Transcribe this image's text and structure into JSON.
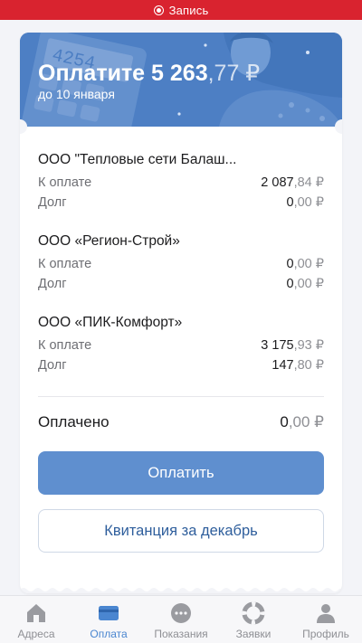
{
  "status_bar": {
    "recording_label": "Запись"
  },
  "banner": {
    "title_main": "Оплатите 5 263",
    "title_kopecks": ",77 ₽",
    "due_text": "до 10 января"
  },
  "bills": [
    {
      "company": "ООО \"Тепловые сети Балаш...",
      "to_pay_label": "К оплате",
      "to_pay_rub": "2 087",
      "to_pay_kop": ",84 ₽",
      "debt_label": "Долг",
      "debt_rub": "0",
      "debt_kop": ",00 ₽"
    },
    {
      "company": "ООО «Регион-Строй»",
      "to_pay_label": "К оплате",
      "to_pay_rub": "0",
      "to_pay_kop": ",00 ₽",
      "debt_label": "Долг",
      "debt_rub": "0",
      "debt_kop": ",00 ₽"
    },
    {
      "company": "ООО «ПИК-Комфорт»",
      "to_pay_label": "К оплате",
      "to_pay_rub": "3 175",
      "to_pay_kop": ",93 ₽",
      "debt_label": "Долг",
      "debt_rub": "147",
      "debt_kop": ",80 ₽"
    }
  ],
  "paid": {
    "label": "Оплачено",
    "rub": "0",
    "kop": ",00 ₽"
  },
  "buttons": {
    "pay": "Оплатить",
    "receipt": "Квитанция за декабрь"
  },
  "tabs": [
    {
      "label": "Адреса",
      "icon": "home-icon",
      "active": false
    },
    {
      "label": "Оплата",
      "icon": "card-icon",
      "active": true
    },
    {
      "label": "Показания",
      "icon": "meter-icon",
      "active": false
    },
    {
      "label": "Заявки",
      "icon": "lifebuoy-icon",
      "active": false
    },
    {
      "label": "Профиль",
      "icon": "person-icon",
      "active": false
    }
  ],
  "colors": {
    "accent": "#4a86d0",
    "banner": "#4d7fc4",
    "recording": "#d9232f",
    "pay_button": "#5f8fcf"
  },
  "banner_decor": {
    "calculator_display": "4254"
  }
}
